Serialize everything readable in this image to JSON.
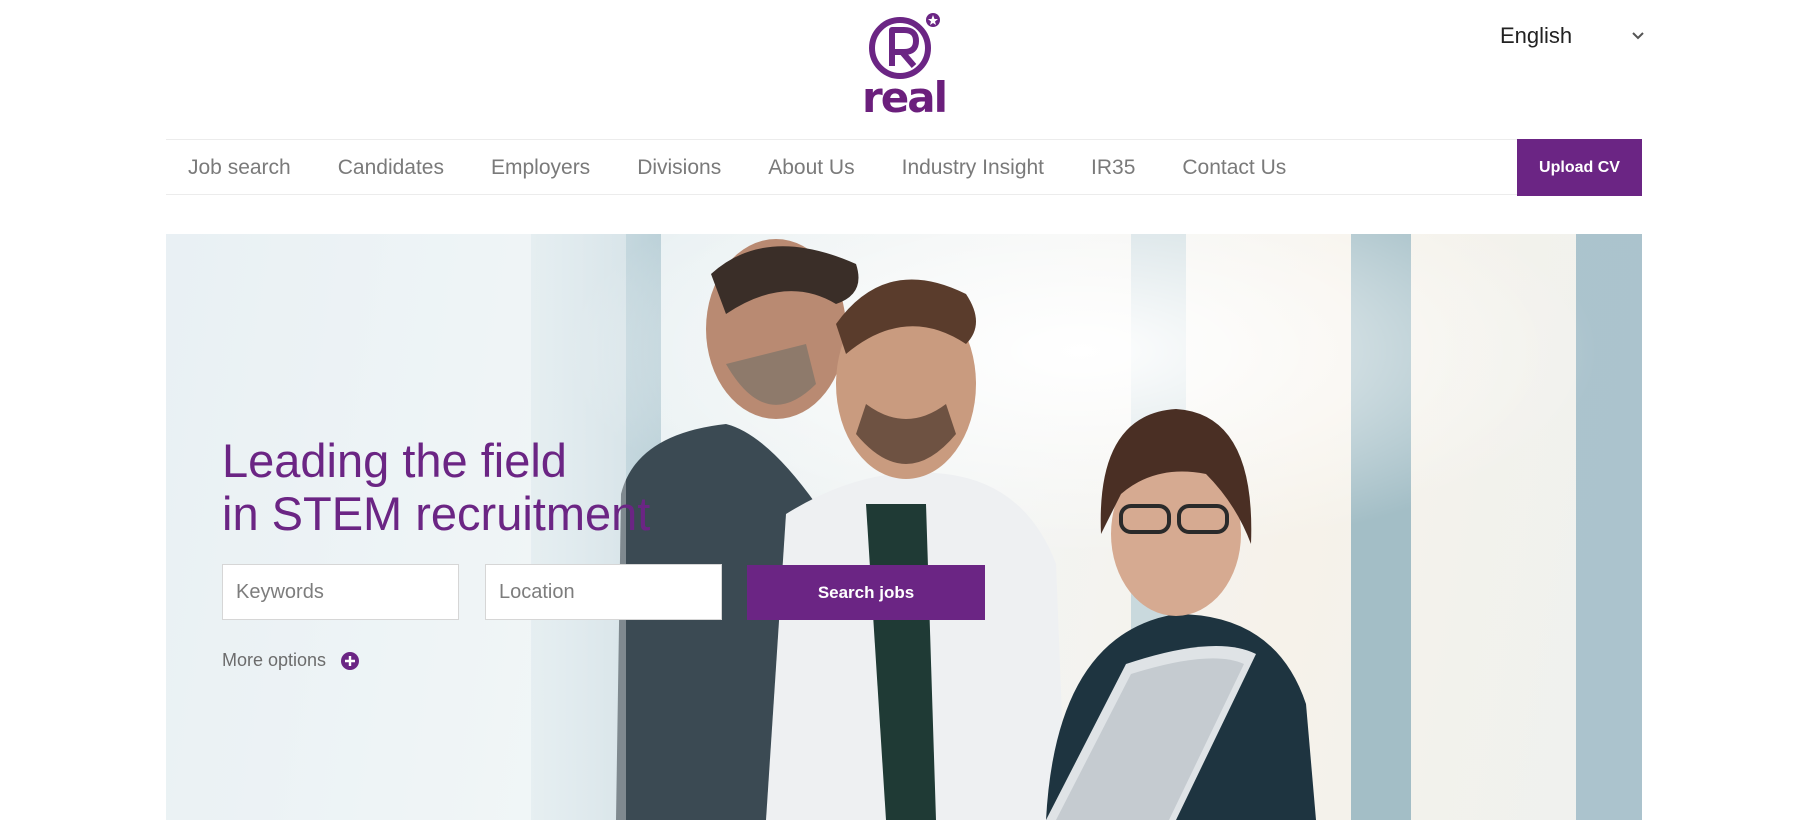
{
  "brand": {
    "logo_text": "real",
    "logo_mark": "R",
    "color": "#6b2584"
  },
  "language": {
    "selected": "English",
    "icon": "chevron-down-icon"
  },
  "nav": {
    "items": [
      {
        "label": "Job search"
      },
      {
        "label": "Candidates"
      },
      {
        "label": "Employers"
      },
      {
        "label": "Divisions"
      },
      {
        "label": "About Us"
      },
      {
        "label": "Industry Insight"
      },
      {
        "label": "IR35"
      },
      {
        "label": "Contact Us"
      }
    ],
    "upload_label": "Upload CV"
  },
  "hero": {
    "headline_line1": "Leading the field",
    "headline_line2": "in STEM recruitment",
    "keywords_placeholder": "Keywords",
    "location_placeholder": "Location",
    "search_label": "Search jobs",
    "more_options_label": "More options",
    "more_options_icon": "plus-circle-icon"
  }
}
